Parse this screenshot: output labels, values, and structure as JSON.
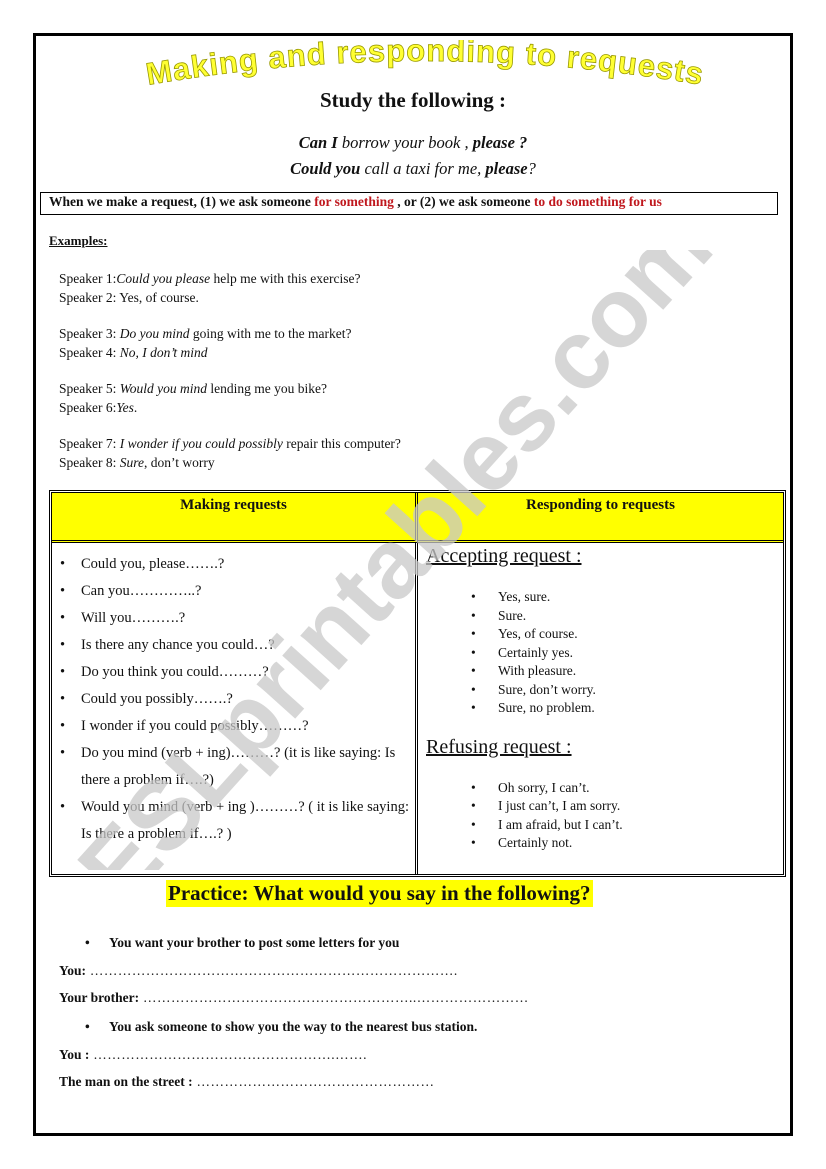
{
  "title": "Making and responding to requests",
  "subtitle": "Study the following :",
  "samples": [
    {
      "bold_start": "Can I",
      "middle": " borrow your book , ",
      "bold_end": "please ?",
      "tail": ""
    },
    {
      "bold_start": "Could you",
      "middle": " call a taxi for me, ",
      "bold_end": "please",
      "tail": "?"
    }
  ],
  "rule": {
    "part1": "When we make a request, (1) we ask someone ",
    "highlight1": "for something",
    "part2": " , or (2) we ask someone ",
    "highlight2": "to do something for us"
  },
  "examples_label": "Examples:",
  "dialogs": [
    {
      "line1_speaker": "Speaker 1:",
      "line1_italic": "Could you please",
      "line1_rest": " help me with this exercise?",
      "line2_speaker": "Speaker 2: ",
      "line2_italic": "",
      "line2_rest": "Yes, of course."
    },
    {
      "line1_speaker": "Speaker 3: ",
      "line1_italic": "Do you mind",
      "line1_rest": " going with me to the market?",
      "line2_speaker": "Speaker 4: ",
      "line2_italic": "No, I don’t mind",
      "line2_rest": ""
    },
    {
      "line1_speaker": "Speaker 5: ",
      "line1_italic": "Would you mind",
      "line1_rest": " lending me you bike?",
      "line2_speaker": "Speaker 6:",
      "line2_italic": "Yes",
      "line2_rest": "."
    },
    {
      "line1_speaker": "Speaker 7: ",
      "line1_italic": "I wonder if you could possibly",
      "line1_rest": " repair this computer?",
      "line2_speaker": "Speaker 8: ",
      "line2_italic": "Sure",
      "line2_rest": ", don’t worry"
    }
  ],
  "table": {
    "header_left": "Making  requests",
    "header_right": "Responding to requests",
    "making": [
      "Could you, please…….?",
      "Can you…………..?",
      "Will you……….?",
      "Is there any chance you could…?",
      "Do you think you could………?",
      "Could you possibly…….?",
      "I wonder if you could possibly………?",
      "Do you mind (verb + ing)………? (it is like saying: Is there a problem if….?)",
      "Would you mind (verb + ing )………? ( it is like saying: Is there a problem if….? )"
    ],
    "accepting_head": "Accepting request :",
    "accepting": [
      "Yes, sure.",
      "Sure.",
      "Yes, of course.",
      "Certainly yes.",
      "With pleasure.",
      "Sure, don’t worry.",
      "Sure, no problem."
    ],
    "refusing_head": "Refusing request :",
    "refusing": [
      "Oh sorry, I can’t.",
      "I just can’t, I am sorry.",
      "I am afraid, but I can’t.",
      "Certainly not."
    ]
  },
  "practice": {
    "title": "Practice: What would you say in the following?",
    "task1": "You want your brother to post some letters for you",
    "task1_answers": [
      {
        "label": "You:",
        "dots": " ……………………………………………………………………."
      },
      {
        "label": "Your brother:",
        "dots": " …………………………………………………..……………………"
      }
    ],
    "task2": "You ask someone to show you the way to the nearest bus station.",
    "task2_answers": [
      {
        "label": "You :",
        "dots": " …………………………………………….……."
      },
      {
        "label": "The man on the street :",
        "dots": " ……………………………………………"
      }
    ]
  },
  "watermark": "ESLprintables.com",
  "colors": {
    "highlight_yellow": "#ffff00",
    "title_yellow": "#ffff33",
    "accent_red": "#c0181e",
    "watermark_gray": "#c8c8c8"
  }
}
